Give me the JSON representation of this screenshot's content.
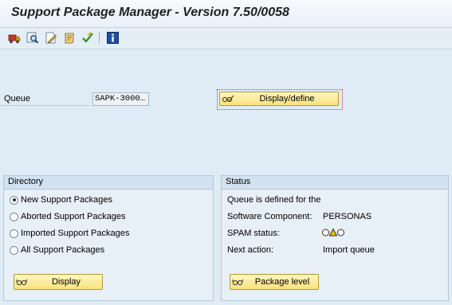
{
  "window": {
    "title": "Support Package Manager - Version 7.50/0058"
  },
  "toolbar": {
    "icons": [
      "truck-icon",
      "search-icon",
      "edit-document-icon",
      "scroll-icon",
      "check-icon",
      "info-icon"
    ]
  },
  "queue": {
    "label": "Queue",
    "value": "SAPK-3000…",
    "button_label": "Display/define"
  },
  "directory": {
    "title": "Directory",
    "options": [
      {
        "label": "New Support Packages",
        "selected": true
      },
      {
        "label": "Aborted Support Packages",
        "selected": false
      },
      {
        "label": "Imported Support Packages",
        "selected": false
      },
      {
        "label": "All Support Packages",
        "selected": false
      }
    ],
    "button_label": "Display"
  },
  "status": {
    "title": "Status",
    "message": "Queue is defined for the",
    "component_label": "Software Component:",
    "component_value": "PERSONAS",
    "spam_label": "SPAM status:",
    "spam_lights": [
      "off",
      "yellow",
      "off"
    ],
    "next_action_label": "Next action:",
    "next_action_value": "Import queue",
    "button_label": "Package level"
  },
  "colors": {
    "background": "#dfebf5",
    "button_yellow": "#fbe27a",
    "focus_red": "#d23b3b",
    "status_yellow": "#f2c200"
  }
}
